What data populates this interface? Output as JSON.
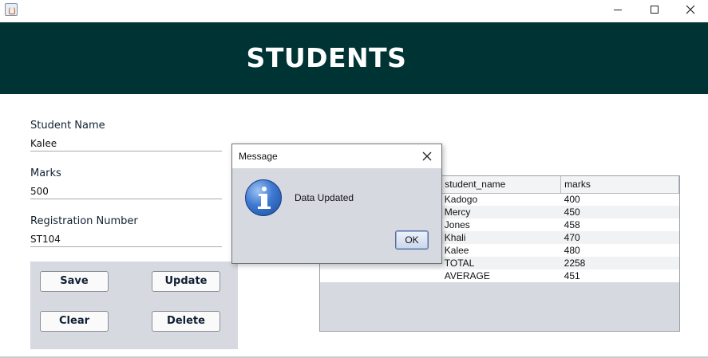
{
  "window": {
    "icon": "java-cup-icon",
    "controls": {
      "minimize": "minimize-icon",
      "maximize": "maximize-icon",
      "close": "close-icon"
    }
  },
  "header": {
    "title": "STUDENTS",
    "background": "#003333"
  },
  "form": {
    "student_name_label": "Student Name",
    "student_name_value": "Kalee",
    "marks_label": "Marks",
    "marks_value": "500",
    "reg_label": "Registration Number",
    "reg_value": "ST104"
  },
  "buttons": {
    "save": "Save",
    "update": "Update",
    "clear": "Clear",
    "delete": "Delete"
  },
  "table": {
    "columns": [
      "",
      "student_name",
      "marks"
    ],
    "rows": [
      [
        "",
        "Kadogo",
        "400"
      ],
      [
        "",
        "Mercy",
        "450"
      ],
      [
        "",
        "Jones",
        "458"
      ],
      [
        "",
        "Khali",
        "470"
      ],
      [
        "",
        "Kalee",
        "480"
      ],
      [
        "",
        "TOTAL",
        "2258"
      ],
      [
        "",
        "AVERAGE",
        "451"
      ]
    ]
  },
  "dialog": {
    "title": "Message",
    "message": "Data Updated",
    "ok_label": "OK",
    "icon": "info-icon"
  }
}
